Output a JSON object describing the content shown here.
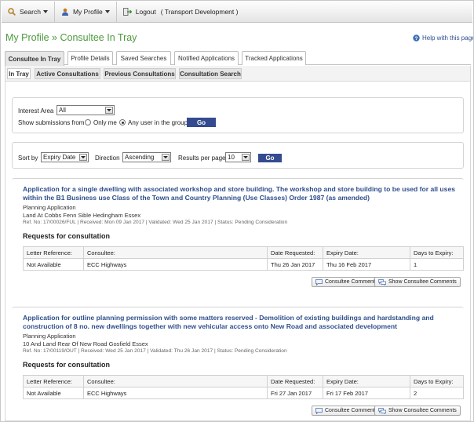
{
  "topbar": {
    "search_label": "Search",
    "myprofile_label": "My Profile",
    "logout_label": "Logout",
    "user_context": "( Transport Development )"
  },
  "page": {
    "title": "My Profile » Consultee In Tray",
    "help_label": "Help with this page"
  },
  "tabs": [
    {
      "label": "Consultee In Tray",
      "active": true
    },
    {
      "label": "Profile Details",
      "active": false
    },
    {
      "label": "Saved Searches",
      "active": false
    },
    {
      "label": "Notified Applications",
      "active": false
    },
    {
      "label": "Tracked Applications",
      "active": false
    }
  ],
  "subtabs": [
    {
      "label": "In Tray",
      "active": true
    },
    {
      "label": "Active Consultations",
      "active": false
    },
    {
      "label": "Previous Consultations",
      "active": false
    },
    {
      "label": "Consultation Search",
      "active": false
    }
  ],
  "filter": {
    "interest_area_label": "Interest Area",
    "interest_area_value": "All",
    "show_from_label": "Show submissions from",
    "only_me_label": "Only me",
    "any_user_label": "Any user in the group",
    "selected_option": "any_user",
    "go_label": "Go"
  },
  "sort": {
    "sort_by_label": "Sort by",
    "sort_by_value": "Expiry Date",
    "direction_label": "Direction",
    "direction_value": "Ascending",
    "per_page_label": "Results per page",
    "per_page_value": "10",
    "go_label": "Go"
  },
  "results_table_headers": {
    "letter": "Letter Reference:",
    "consultee": "Consultee:",
    "date_requested": "Date Requested:",
    "expiry": "Expiry Date:",
    "days": "Days to Expiry:"
  },
  "requests_title": "Requests for consultation",
  "comment_button_label": "Consultee Comment",
  "show_comments_button_label": "Show Consultee Comments",
  "applications": [
    {
      "title": "Application for a single dwelling with associated workshop and store building. The workshop and store building to be used for all uses within the B1 Business use Class of the Town and Country Planning (Use Classes) Order 1987 (as amended)",
      "type": "Planning Application",
      "address": "Land At Cobbs Fenn Sible Hedingham Essex",
      "meta": "Ref. No: 17/00026/FUL | Received: Mon 09 Jan 2017 | Validated: Wed 25 Jan 2017 | Status: Pending Consideration",
      "row": {
        "letter": "Not Available",
        "consultee": "ECC Highways",
        "date_requested": "Thu 26 Jan 2017",
        "expiry": "Thu 16 Feb 2017",
        "days": "1"
      }
    },
    {
      "title": "Application for outline planning permission with some matters reserved - Demolition of existing buildings and hardstanding and construction of 8 no. new dwellings together with new vehicular access onto New Road and associated development",
      "type": "Planning Application",
      "address": "10 And Land Rear Of New Road Gosfield Essex",
      "meta": "Ref. No: 17/00119/OUT | Received: Wed 25 Jan 2017 | Validated: Thu 26 Jan 2017 | Status: Pending Consideration",
      "row": {
        "letter": "Not Available",
        "consultee": "ECC Highways",
        "date_requested": "Fri 27 Jan 2017",
        "expiry": "Fri 17 Feb 2017",
        "days": "2"
      }
    }
  ]
}
